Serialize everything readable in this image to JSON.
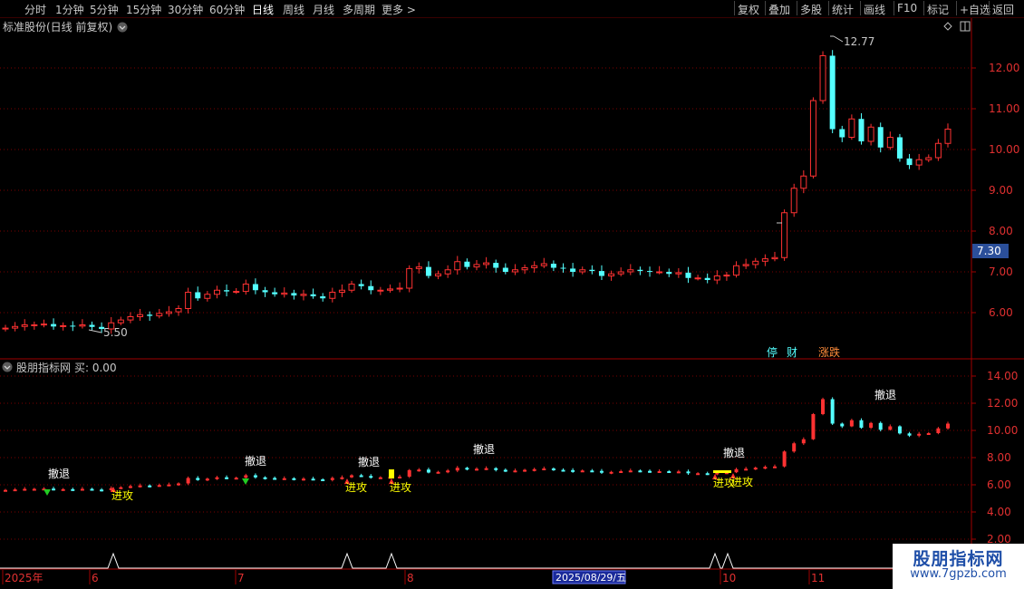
{
  "toolbar": {
    "periods": [
      {
        "label": "分时",
        "active": false
      },
      {
        "label": "1分钟",
        "active": false
      },
      {
        "label": "5分钟",
        "active": false
      },
      {
        "label": "15分钟",
        "active": false
      },
      {
        "label": "30分钟",
        "active": false
      },
      {
        "label": "60分钟",
        "active": false
      },
      {
        "label": "日线",
        "active": true
      },
      {
        "label": "周线",
        "active": false
      },
      {
        "label": "月线",
        "active": false
      },
      {
        "label": "多周期",
        "active": false
      },
      {
        "label": "更多 >",
        "active": false
      }
    ],
    "right_buttons": [
      "复权",
      "叠加",
      "多股",
      "统计",
      "画线",
      "F10",
      "标记",
      "+自选",
      "返回"
    ]
  },
  "main_panel": {
    "title": "标准股份(日线 前复权)",
    "price_axis": [
      "12.00",
      "11.00",
      "10.00",
      "9.00",
      "8.00",
      "7.00",
      "6.00"
    ],
    "current_price": "7.30",
    "high_label": "12.77",
    "low_label": "5.50",
    "bottom_markers": {
      "m1": "停",
      "m2": "财",
      "m3": "涨跌"
    }
  },
  "indicator_panel": {
    "title": "股朋指标网",
    "value_text": "买: 0.00",
    "axis": [
      "14.00",
      "12.00",
      "10.00",
      "8.00",
      "6.00",
      "4.00",
      "2.00"
    ],
    "retreat_label": "撤退",
    "attack_label": "进攻"
  },
  "date_axis": {
    "labels": [
      "2025年",
      "6",
      "7",
      "8",
      "10",
      "11"
    ],
    "cursor_date": "2025/08/29/五"
  },
  "watermark": {
    "title": "股朋指标网",
    "url": "www.7gpzb.com"
  },
  "colors": {
    "up": "#ff3232",
    "down": "#54ffff",
    "axis": "#a00000",
    "bg": "#000000"
  },
  "chart_data": {
    "type": "candlestick",
    "closes": [
      5.62,
      5.66,
      5.7,
      5.7,
      5.72,
      5.66,
      5.68,
      5.67,
      5.7,
      5.65,
      5.6,
      5.75,
      5.82,
      5.9,
      5.95,
      5.92,
      5.98,
      6.02,
      6.1,
      6.5,
      6.35,
      6.45,
      6.55,
      6.52,
      6.52,
      6.7,
      6.55,
      6.5,
      6.45,
      6.48,
      6.42,
      6.45,
      6.4,
      6.35,
      6.5,
      6.55,
      6.7,
      6.65,
      6.55,
      6.55,
      6.58,
      6.6,
      7.08,
      7.12,
      6.9,
      6.95,
      7.05,
      7.25,
      7.12,
      7.18,
      7.22,
      7.1,
      7.0,
      7.05,
      7.1,
      7.15,
      7.2,
      7.1,
      7.08,
      7.0,
      7.05,
      7.02,
      6.9,
      6.95,
      7.0,
      7.05,
      7.02,
      7.0,
      7.0,
      6.95,
      6.98,
      6.85,
      6.85,
      6.8,
      6.9,
      6.92,
      7.15,
      7.18,
      7.26,
      7.32,
      7.35,
      8.45,
      9.05,
      9.35,
      11.2,
      12.3,
      10.5,
      10.3,
      10.75,
      10.2,
      10.55,
      10.05,
      10.3,
      9.78,
      9.62,
      9.75,
      9.8,
      10.15,
      10.5
    ]
  }
}
